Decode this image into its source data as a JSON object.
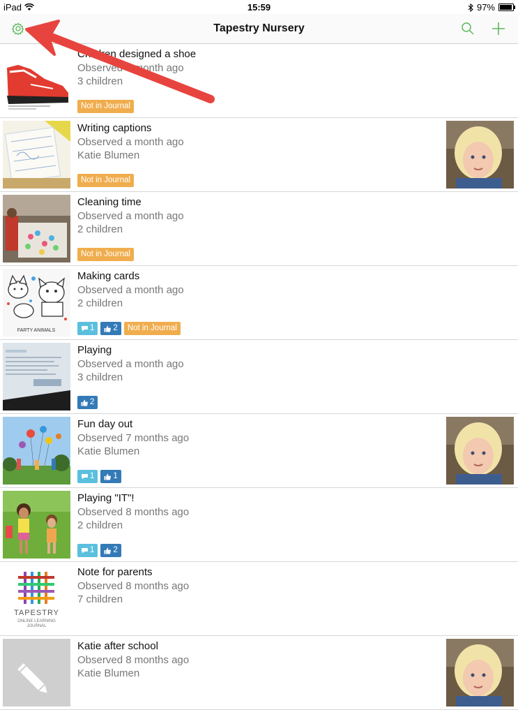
{
  "status": {
    "device": "iPad",
    "time": "15:59",
    "battery": "97%",
    "battery_level": 0.97
  },
  "nav": {
    "title": "Tapestry Nursery"
  },
  "colors": {
    "accent": "#5cb85c",
    "orange": "#f0ad4e",
    "cyan": "#5bc0de",
    "blue": "#337ab7",
    "arrow": "#e8443f"
  },
  "rows": [
    {
      "title": "Children designed a shoe",
      "observed": "Observed a month ago",
      "who": "3 children",
      "journal": "Not in Journal"
    },
    {
      "title": "Writing captions",
      "observed": "Observed a month ago",
      "who": "Katie Blumen",
      "journal": "Not in Journal"
    },
    {
      "title": "Cleaning time",
      "observed": "Observed a month ago",
      "who": "2 children",
      "journal": "Not in Journal"
    },
    {
      "title": "Making cards",
      "observed": "Observed a month ago",
      "who": "2 children",
      "comments": "1",
      "likes": "2",
      "journal": "Not in Journal",
      "thumb_text": "FARTY ANIMALS"
    },
    {
      "title": "Playing",
      "observed": "Observed a month ago",
      "who": "3 children",
      "likes": "2"
    },
    {
      "title": "Fun day out",
      "observed": "Observed 7 months ago",
      "who": "Katie Blumen",
      "comments": "1",
      "likes": "1"
    },
    {
      "title": "Playing \"IT\"!",
      "observed": "Observed 8 months ago",
      "who": "2 children",
      "comments": "1",
      "likes": "2"
    },
    {
      "title": "Note for parents",
      "observed": "Observed 8 months ago",
      "who": "7 children",
      "logo_text": "TAPESTRY",
      "logo_sub1": "ONLINE LEARNING",
      "logo_sub2": "JOURNAL"
    },
    {
      "title": "Katie after school",
      "observed": "Observed 8 months ago",
      "who": "Katie Blumen"
    }
  ]
}
